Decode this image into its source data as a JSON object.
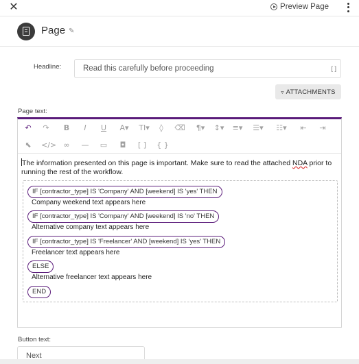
{
  "topbar": {
    "close_glyph": "✕",
    "preview_label": "Preview Page"
  },
  "header": {
    "title": "Page"
  },
  "headline": {
    "label": "Headline:",
    "value": "Read this carefully before proceeding",
    "brackets_glyph": "[ ]"
  },
  "attachments": {
    "label": "ATTACHMENTS"
  },
  "page_text": {
    "label": "Page text:",
    "intro_part1": "The information presented on this page is important. Make sure to read the attached ",
    "intro_nda": "NDA",
    "intro_part2": " prior to running the rest of the workflow.",
    "conditions": [
      {
        "pill": "IF [contractor_type] IS 'Company' AND [weekend] IS 'yes' THEN",
        "text": "Company weekend text appears here"
      },
      {
        "pill": "IF [contractor_type] IS 'Company' AND [weekend] IS 'no' THEN",
        "text": "Alternative company text appears here"
      },
      {
        "pill": "IF [contractor_type] IS 'Freelancer' AND [weekend] IS 'yes' THEN",
        "text": "Freelancer text appears here"
      },
      {
        "pill": "ELSE",
        "text": "Alternative freelancer text appears here"
      },
      {
        "pill": "END",
        "text": ""
      }
    ]
  },
  "button_text": {
    "label": "Button text:",
    "value": "Next"
  },
  "colors": {
    "accent": "#5a1b7a"
  }
}
